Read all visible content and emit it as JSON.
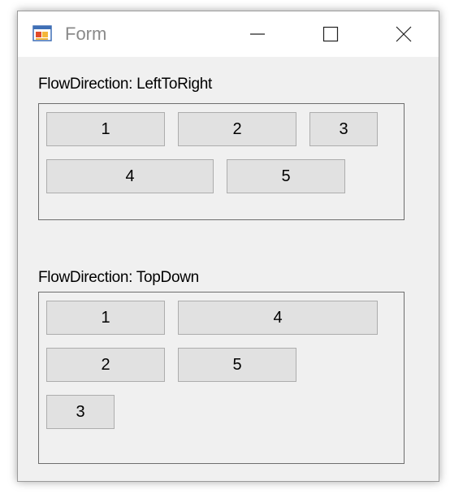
{
  "window": {
    "title": "Form",
    "icon": "form-app-icon",
    "controls": {
      "minimize": "minimize-icon",
      "maximize": "maximize-icon",
      "close": "close-icon"
    }
  },
  "groups": {
    "left_to_right": {
      "label": "FlowDirection: LeftToRight",
      "buttons": [
        "1",
        "2",
        "3",
        "4",
        "5"
      ]
    },
    "top_down": {
      "label": "FlowDirection: TopDown",
      "buttons": [
        "1",
        "2",
        "3",
        "4",
        "5"
      ]
    }
  },
  "colors": {
    "window_background": "#f0f0f0",
    "button_face": "#e1e1e1",
    "button_border": "#adadad",
    "panel_border": "#6e6e6e"
  }
}
